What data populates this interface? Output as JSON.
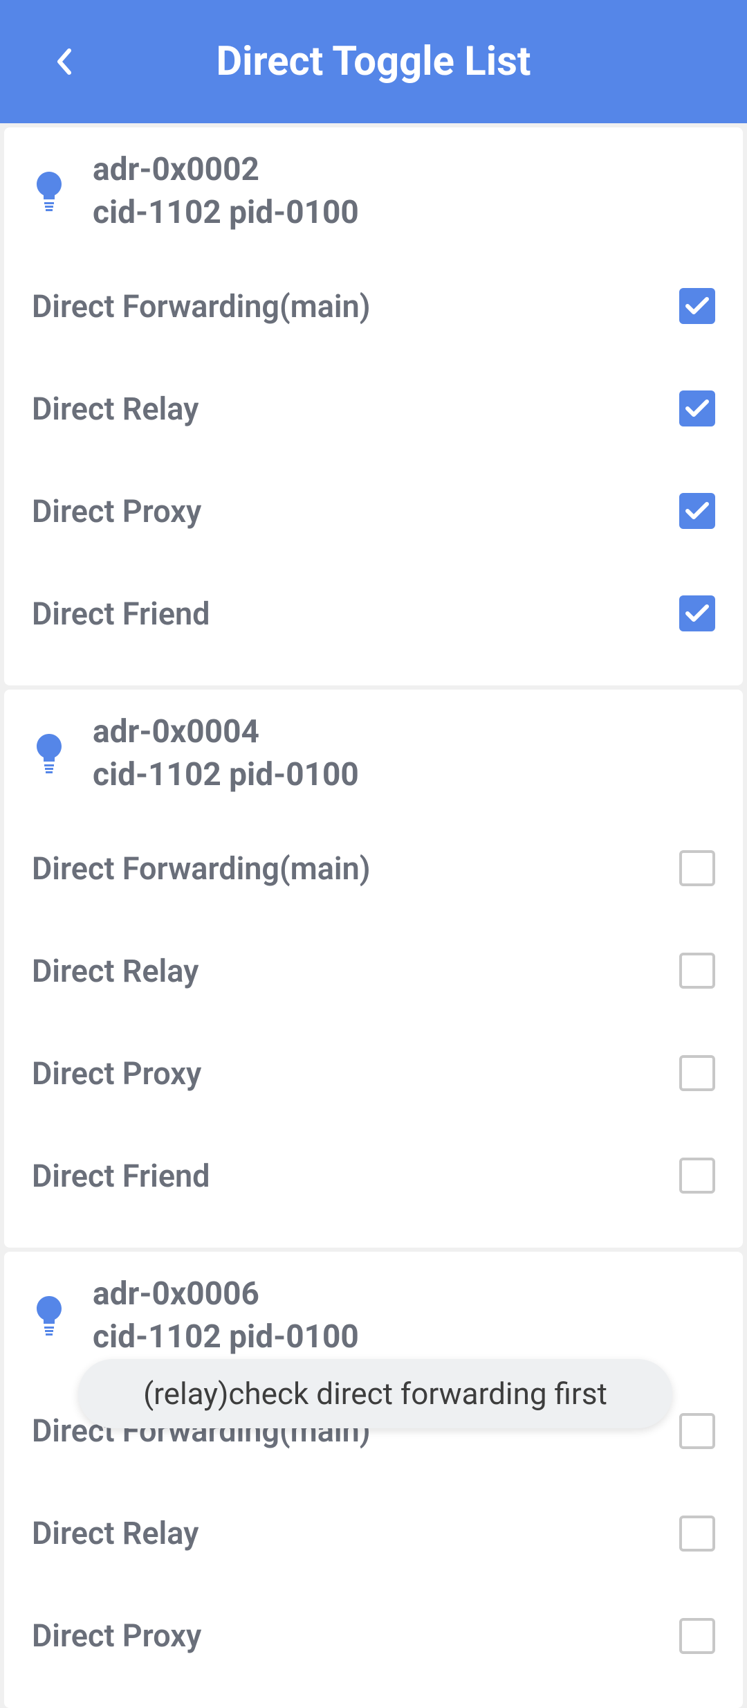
{
  "header": {
    "title": "Direct Toggle List"
  },
  "cards": [
    {
      "title_line1": "adr-0x0002",
      "title_line2": "cid-1102 pid-0100",
      "toggles": [
        {
          "label": "Direct Forwarding(main)",
          "checked": true
        },
        {
          "label": "Direct Relay",
          "checked": true
        },
        {
          "label": "Direct Proxy",
          "checked": true
        },
        {
          "label": "Direct Friend",
          "checked": true
        }
      ]
    },
    {
      "title_line1": "adr-0x0004",
      "title_line2": "cid-1102 pid-0100",
      "toggles": [
        {
          "label": "Direct Forwarding(main)",
          "checked": false
        },
        {
          "label": "Direct Relay",
          "checked": false
        },
        {
          "label": "Direct Proxy",
          "checked": false
        },
        {
          "label": "Direct Friend",
          "checked": false
        }
      ]
    },
    {
      "title_line1": "adr-0x0006",
      "title_line2": "cid-1102 pid-0100",
      "toggles": [
        {
          "label": "Direct Forwarding(main)",
          "checked": false
        },
        {
          "label": "Direct Relay",
          "checked": false
        },
        {
          "label": "Direct Proxy",
          "checked": false
        }
      ]
    }
  ],
  "toast": {
    "message": "(relay)check direct forwarding first"
  }
}
